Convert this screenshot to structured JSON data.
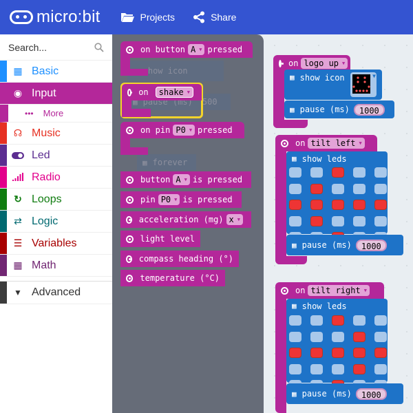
{
  "header": {
    "logo_text": "micro:bit",
    "projects_label": "Projects",
    "share_label": "Share",
    "colors": {
      "bar": "#3454d1"
    }
  },
  "sidebar": {
    "search_placeholder": "Search...",
    "categories": [
      {
        "label": "Basic",
        "icon": "grid-icon",
        "color": "#1e90ff"
      },
      {
        "label": "Input",
        "icon": "radio-button-icon",
        "color": "#b4279a",
        "active": true
      },
      {
        "label": "More",
        "icon": "more-dots-icon",
        "color": "#b4279a",
        "sub": true
      },
      {
        "label": "Music",
        "icon": "headphones-icon",
        "color": "#e63022"
      },
      {
        "label": "Led",
        "icon": "toggle-icon",
        "color": "#5c2d91"
      },
      {
        "label": "Radio",
        "icon": "signal-bars-icon",
        "color": "#e3008c"
      },
      {
        "label": "Loops",
        "icon": "loop-arrow-icon",
        "color": "#107c10"
      },
      {
        "label": "Logic",
        "icon": "shuffle-icon",
        "color": "#006970"
      },
      {
        "label": "Variables",
        "icon": "lines-icon",
        "color": "#a80000"
      },
      {
        "label": "Math",
        "icon": "calculator-icon",
        "color": "#712672"
      }
    ],
    "advanced_label": "Advanced"
  },
  "flyout": {
    "blocks": [
      {
        "type": "hat",
        "parts": [
          "on button",
          "A",
          "pressed"
        ]
      },
      {
        "type": "hat",
        "parts": [
          "on",
          "shake"
        ],
        "highlighted": true
      },
      {
        "type": "hat",
        "parts": [
          "on pin",
          "P0",
          "pressed"
        ]
      },
      {
        "type": "reporter",
        "parts": [
          "button",
          "A",
          "is pressed"
        ]
      },
      {
        "type": "reporter",
        "parts": [
          "pin",
          "P0",
          "is pressed"
        ]
      },
      {
        "type": "reporter",
        "parts": [
          "acceleration (mg)",
          "x"
        ]
      },
      {
        "type": "reporter",
        "parts": [
          "light level"
        ]
      },
      {
        "type": "reporter",
        "parts": [
          "compass heading (°)"
        ]
      },
      {
        "type": "reporter",
        "parts": [
          "temperature (°C)"
        ]
      }
    ],
    "ghost_blocks": [
      "show icon",
      "pause (ms)",
      "500",
      "forever"
    ]
  },
  "workspace": {
    "events": [
      {
        "event": "logo up",
        "on_label": "on",
        "statement": "show icon",
        "pause_label": "pause (ms)",
        "pause_value": "1000"
      },
      {
        "event": "tilt left",
        "on_label": "on",
        "statement": "show leds",
        "leds": [
          [
            0,
            0,
            1,
            0,
            0
          ],
          [
            0,
            1,
            0,
            0,
            0
          ],
          [
            1,
            1,
            1,
            1,
            1
          ],
          [
            0,
            1,
            0,
            0,
            0
          ],
          [
            0,
            0,
            1,
            0,
            0
          ]
        ],
        "pause_label": "pause (ms)",
        "pause_value": "1000"
      },
      {
        "event": "tilt right",
        "on_label": "on",
        "statement": "show leds",
        "leds": [
          [
            0,
            0,
            1,
            0,
            0
          ],
          [
            0,
            0,
            0,
            1,
            0
          ],
          [
            1,
            1,
            1,
            1,
            1
          ],
          [
            0,
            0,
            0,
            1,
            0
          ],
          [
            0,
            0,
            1,
            0,
            0
          ]
        ],
        "pause_label": "pause (ms)",
        "pause_value": "1000"
      }
    ]
  }
}
